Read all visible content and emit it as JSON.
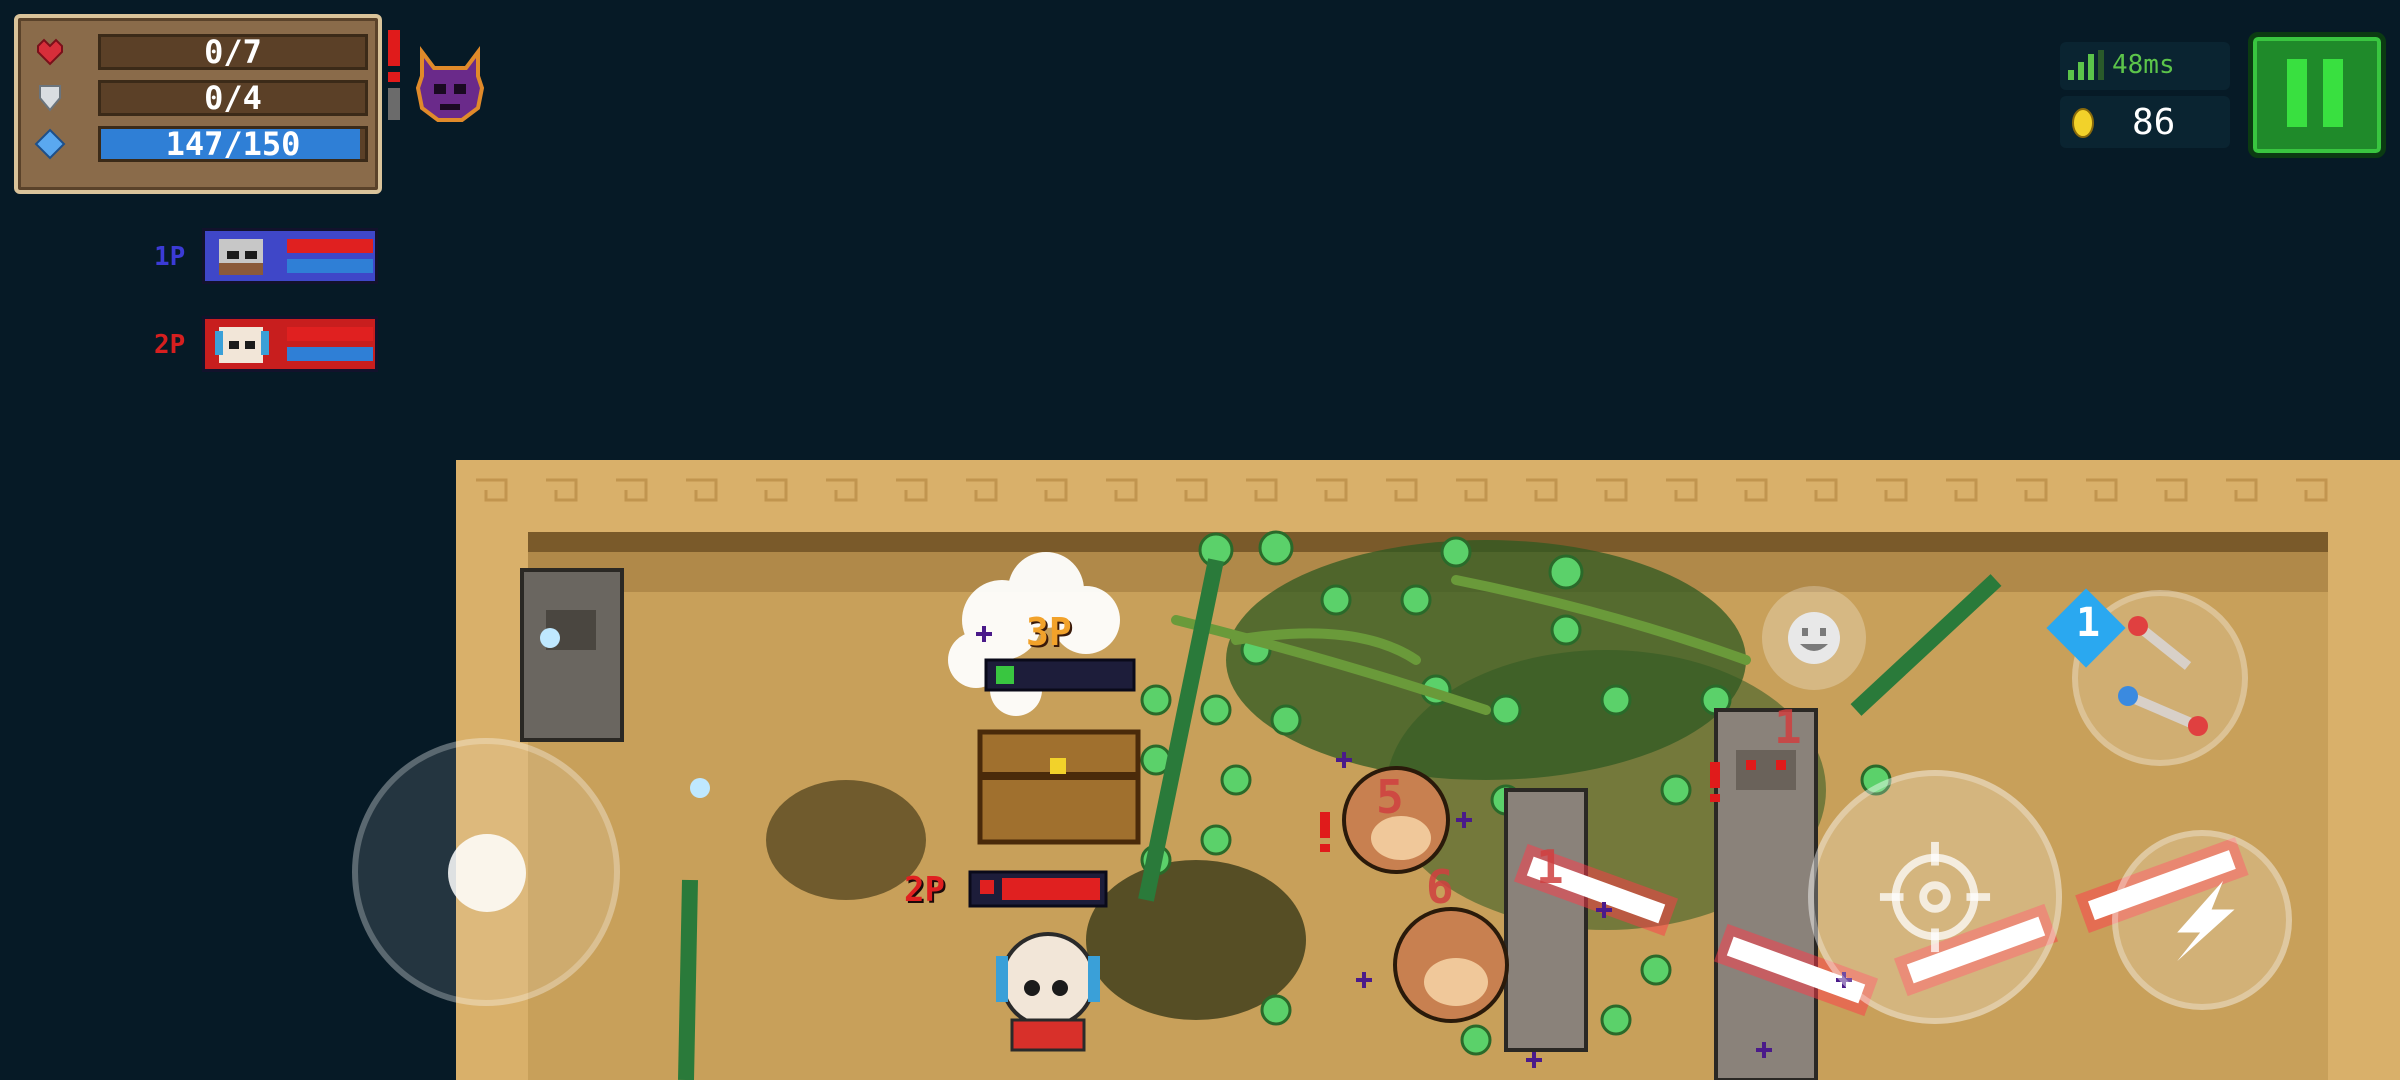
{
  "stats": {
    "health": {
      "current": 0,
      "max": 7,
      "label": "0/7"
    },
    "armor": {
      "current": 0,
      "max": 4,
      "label": "0/4"
    },
    "energy": {
      "current": 147,
      "max": 150,
      "label": "147/150"
    }
  },
  "players": [
    {
      "tag": "1P",
      "color": "#3b3bd6"
    },
    {
      "tag": "2P",
      "color": "#d61f1f"
    }
  ],
  "network": {
    "ping": "48ms"
  },
  "coins": {
    "count": "86"
  },
  "world_labels": {
    "player3_tag": "3P",
    "player2_tag": "2P",
    "damage_5": "5",
    "damage_6": "6",
    "damage_1": "1",
    "damage_1b": "1",
    "weapon_slot_number": "1"
  },
  "colors": {
    "background": "#061a26",
    "health": "#d72e3a",
    "armor": "#bfc7cf",
    "energy": "#2f7fd6",
    "pause_green": "#39c640",
    "floor": "#c8a05a"
  },
  "icons": [
    "heart-icon",
    "shield-icon",
    "energy-gem-icon",
    "boss-demon-icon",
    "signal-icon",
    "coin-icon",
    "pause-icon",
    "emote-icon",
    "weapon-swap-icon",
    "crosshair-icon",
    "skill-bolt-icon"
  ]
}
